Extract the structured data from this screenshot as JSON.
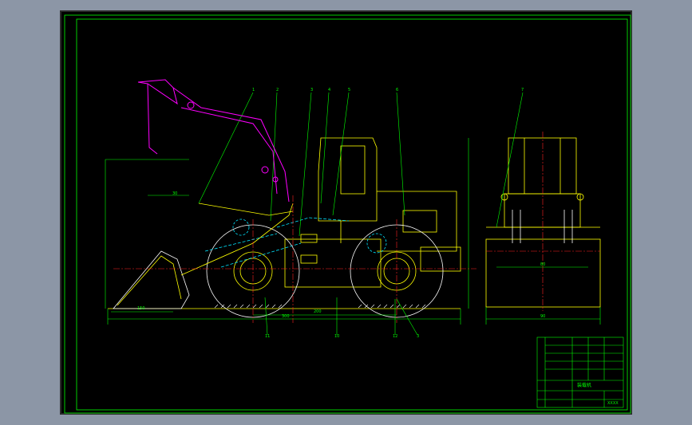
{
  "viewport": {
    "background": "#8c96a6",
    "sheet_background": "#000000"
  },
  "colors": {
    "frame": "#00ff00",
    "body": "#ffff00",
    "dimension": "#00ff00",
    "center_line": "#ff2020",
    "boom_linkage": "#ff00ff",
    "hidden_parts": "#00e5ff",
    "white_detail": "#ffffff"
  },
  "part_leaders_side": [
    "1",
    "2",
    "3",
    "4",
    "5",
    "6"
  ],
  "part_leaders_front": [
    "7"
  ],
  "dimensions": {
    "boom_height": "30",
    "bucket_length": "150",
    "wheelbase": "200",
    "overall_length": "300",
    "front_width": "80",
    "front_total_width": "90",
    "lower_1": "11",
    "lower_2": "10",
    "lower_3": "12",
    "lower_4": "3"
  },
  "title_block": {
    "title": "装载机",
    "company": "XXXX"
  }
}
